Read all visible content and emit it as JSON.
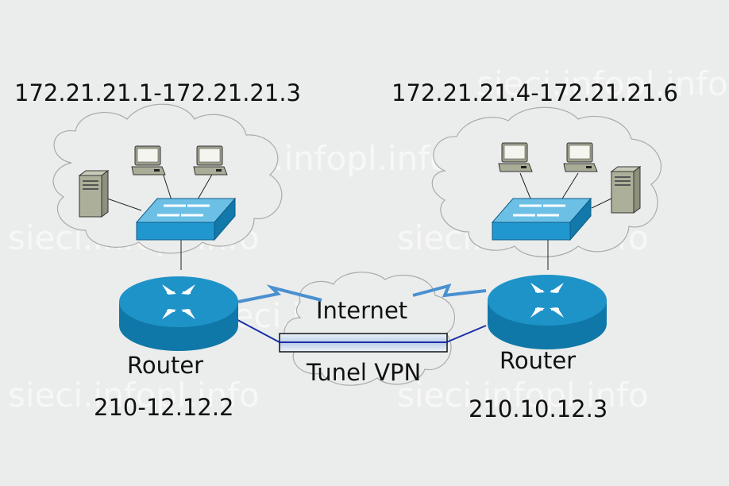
{
  "subnet_left": "172.21.21.1-172.21.21.3",
  "subnet_right": "172.21.21.4-172.21.21.6",
  "internet_label": "Internet",
  "tunnel_label": "Tunel VPN",
  "router_left": {
    "label": "Router",
    "ip": "210-12.12.2"
  },
  "router_right": {
    "label": "Router",
    "ip": "210.10.12.3"
  },
  "watermark": "sieci.infopl.info",
  "colors": {
    "background": "#ebedec",
    "router": "#1a8fc0",
    "switch": "#2a9ad0",
    "tunnel_line": "#1d2fa8",
    "link_bolt": "#4a90d0"
  },
  "icons": [
    "router-icon",
    "switch-icon",
    "pc-icon",
    "server-icon",
    "cloud-icon",
    "lightning-link-icon"
  ]
}
